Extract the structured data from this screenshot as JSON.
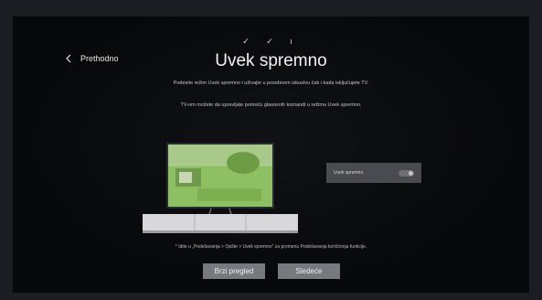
{
  "screen": {
    "progress_marks": "✓ ✓ ı",
    "back_label": "Prethodno",
    "title": "Uvek spremno",
    "description_1": "Podesite režim Uvek spremno i uživajte u posebnom iskustvu čak i kada isključujete TV.",
    "description_2": "TV-om možete da upravljate pomoću glasovnih komandi u režimu Uvek spremno.",
    "toggle": {
      "label": "Uvek spremno",
      "state": "off"
    },
    "note": "* Idite u „Podešavanja > Opšte > Uvek spremno“ za promenu Podešavanja korišćenja funkcije.",
    "buttons": {
      "quick_view": "Brzi pregled",
      "next": "Sledeće"
    }
  },
  "colors": {
    "button_bg": "#77797f",
    "card_bg": "#4a4b50",
    "text": "#f2f2f2"
  }
}
